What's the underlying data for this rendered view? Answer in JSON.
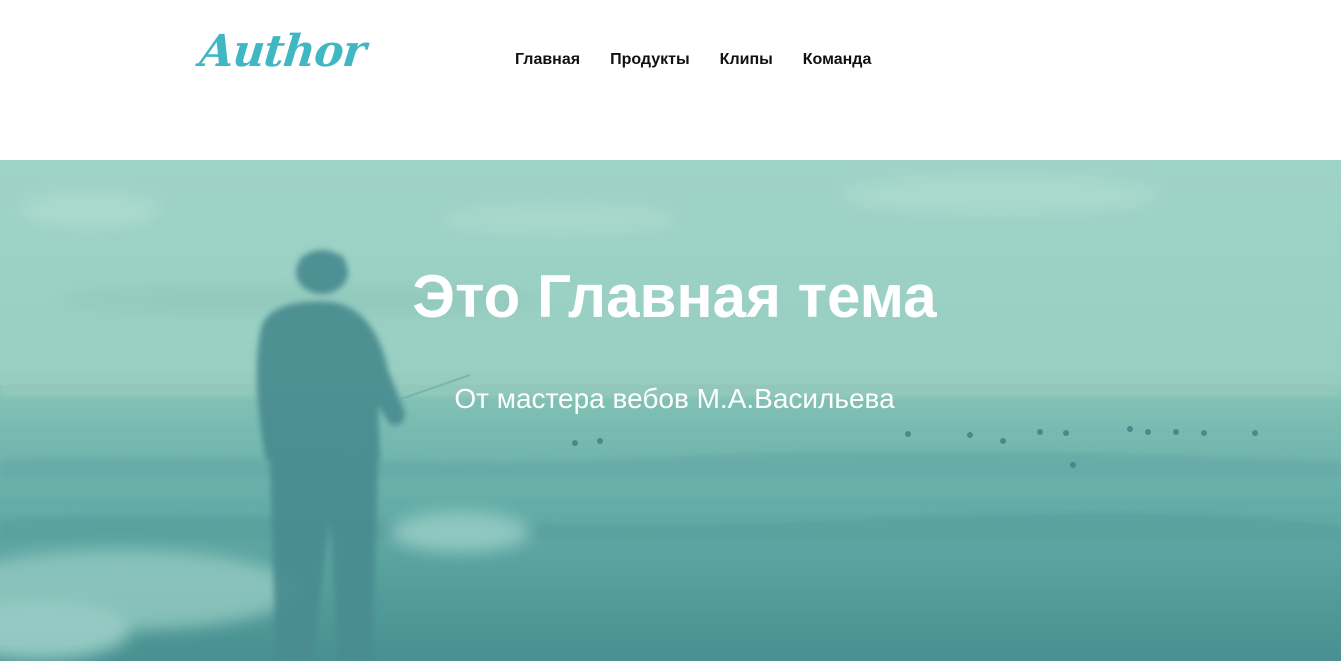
{
  "header": {
    "logo_text": "Author",
    "nav": [
      {
        "label": "Главная"
      },
      {
        "label": "Продукты"
      },
      {
        "label": "Клипы"
      },
      {
        "label": "Команда"
      }
    ]
  },
  "hero": {
    "title": "Это Главная тема",
    "subtitle": "От мастера вебов М.А.Васильева",
    "background_image": "man-fishing-by-sea-icon"
  },
  "colors": {
    "logo": "#3fb8c4",
    "nav_text": "#111111",
    "hero_overlay": "#7fc6b8",
    "hero_text": "#ffffff"
  }
}
